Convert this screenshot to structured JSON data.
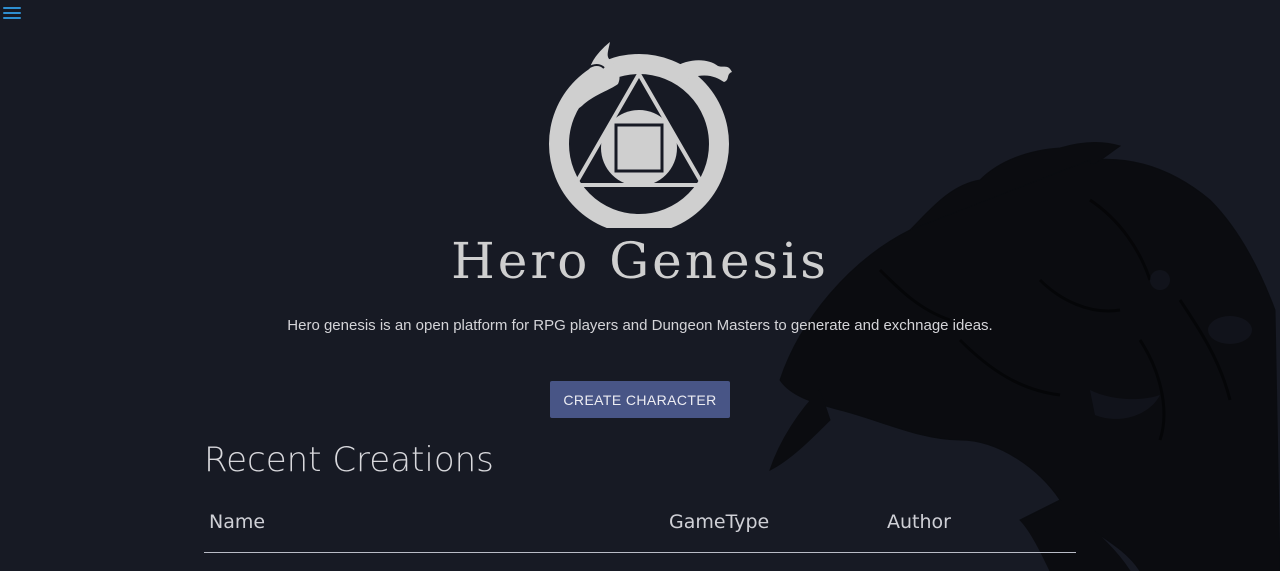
{
  "nav": {
    "menu_icon": "hamburger-menu-icon"
  },
  "brand": {
    "logo_icon": "dragon-circle-triangle-logo",
    "title": "Hero Genesis"
  },
  "hero": {
    "tagline": "Hero genesis is an open platform for RPG players and Dungeon Masters to generate and exchnage ideas.",
    "cta_label": "CREATE CHARACTER"
  },
  "recent": {
    "title": "Recent Creations",
    "columns": [
      "Name",
      "GameType",
      "Author"
    ],
    "rows": []
  },
  "colors": {
    "background": "#171a24",
    "accent_button": "#485586",
    "menu_icon": "#2e8fd1",
    "text": "#d4d4d8"
  }
}
